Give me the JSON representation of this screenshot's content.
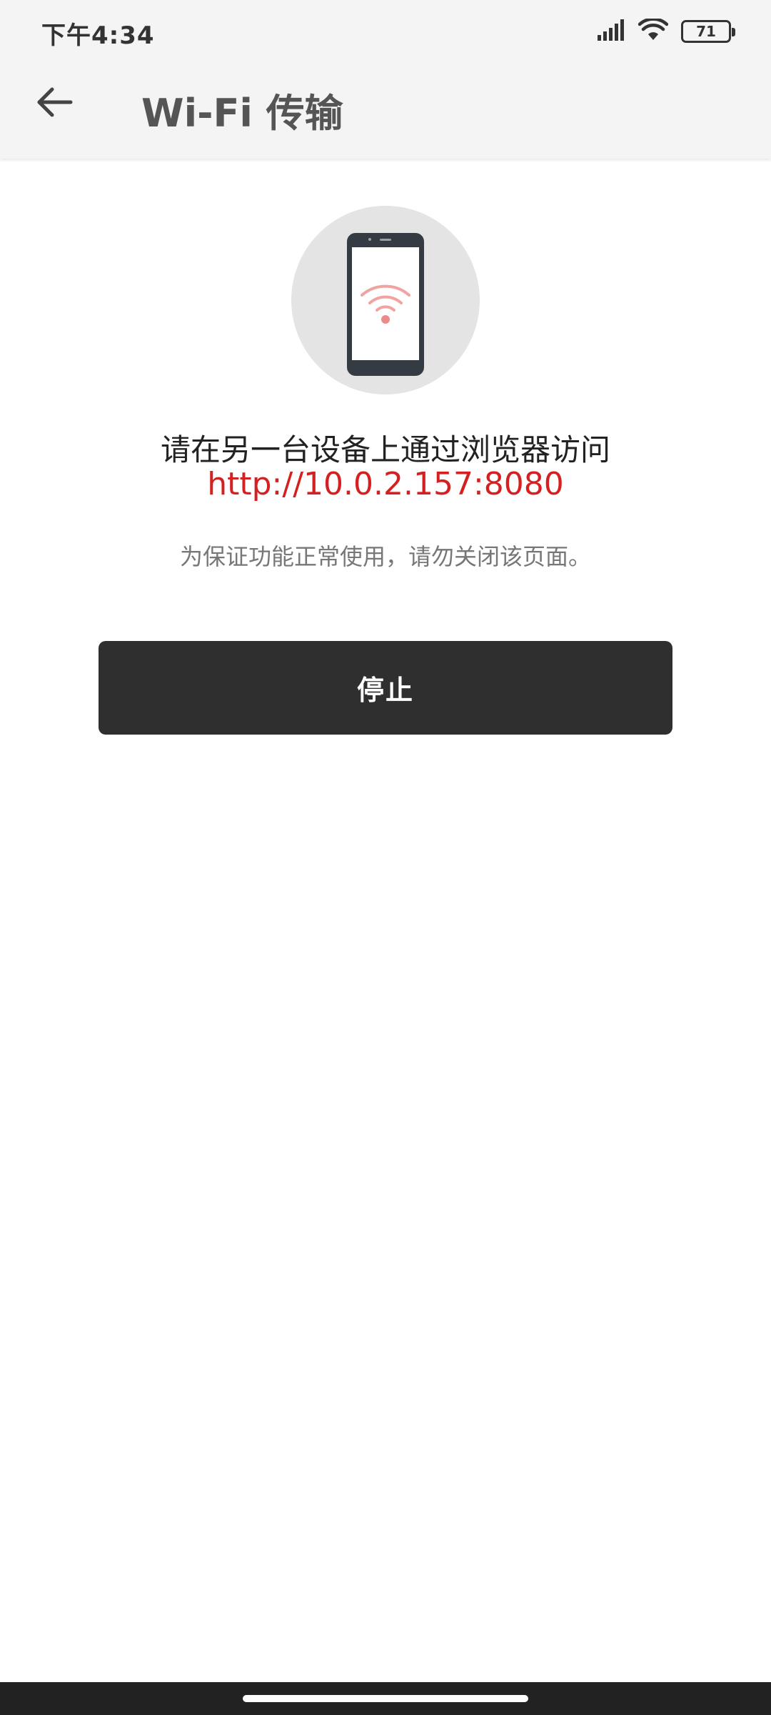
{
  "status_bar": {
    "time": "下午4:34",
    "battery": "71",
    "signal_icon": "signal-icon",
    "wifi_icon": "wifi-icon"
  },
  "app_bar": {
    "back_icon": "arrow-left-icon",
    "title": "Wi-Fi 传输"
  },
  "main": {
    "illustration_icon": "phone-wifi-icon",
    "instruction": "请在另一台设备上通过浏览器访问",
    "url": "http://10.0.2.157:8080",
    "note": "为保证功能正常使用，请勿关闭该页面。",
    "stop_label": "停止"
  },
  "colors": {
    "accent_url": "#d42020",
    "button_bg": "#2f2f2f",
    "wifi_pink": "#f0a4a0"
  }
}
